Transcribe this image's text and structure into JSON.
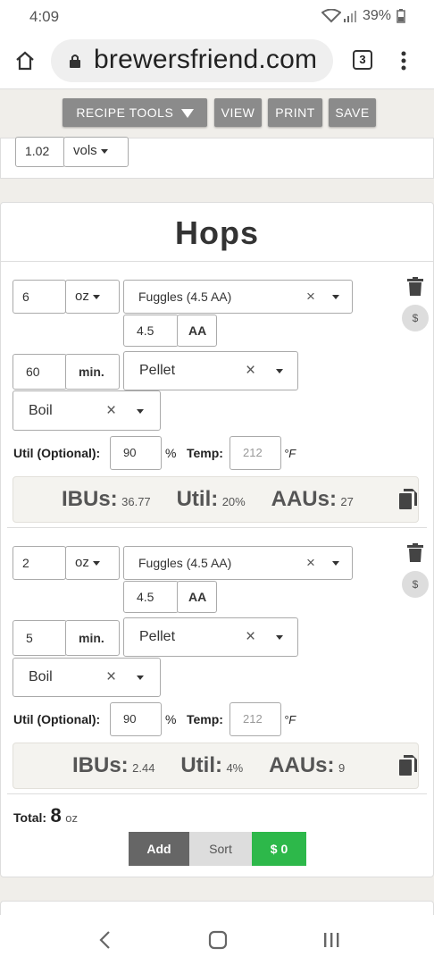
{
  "status": {
    "time": "4:09",
    "battery": "39%"
  },
  "browser": {
    "url": "brewersfriend.com",
    "tab_count": "3"
  },
  "toolbar": {
    "recipe_tools": "RECIPE TOOLS",
    "view": "VIEW",
    "print": "PRINT",
    "save": "SAVE"
  },
  "prev": {
    "value": "1.02",
    "unit": "vols"
  },
  "hops": {
    "title": "Hops",
    "util_label": "Util (Optional):",
    "percent": "%",
    "temp_label": "Temp:",
    "temp_unit": "°F",
    "ibus_label": "IBUs:",
    "util_stat_label": "Util:",
    "aaus_label": "AAUs:",
    "aa_label": "AA",
    "items": [
      {
        "amount": "6",
        "unit": "oz",
        "variety": "Fuggles (4.5 AA)",
        "aa": "4.5",
        "time": "60",
        "time_unit": "min.",
        "form": "Pellet",
        "use": "Boil",
        "util": "90",
        "temp_placeholder": "212",
        "ibus": "36.77",
        "util_pct": "20%",
        "aaus": "27"
      },
      {
        "amount": "2",
        "unit": "oz",
        "variety": "Fuggles (4.5 AA)",
        "aa": "4.5",
        "time": "5",
        "time_unit": "min.",
        "form": "Pellet",
        "use": "Boil",
        "util": "90",
        "temp_placeholder": "212",
        "ibus": "2.44",
        "util_pct": "4%",
        "aaus": "9"
      }
    ],
    "total_label": "Total:",
    "total_value": "8",
    "total_unit": "oz",
    "add": "Add",
    "sort": "Sort",
    "cost": "$ 0",
    "dollar": "$"
  }
}
